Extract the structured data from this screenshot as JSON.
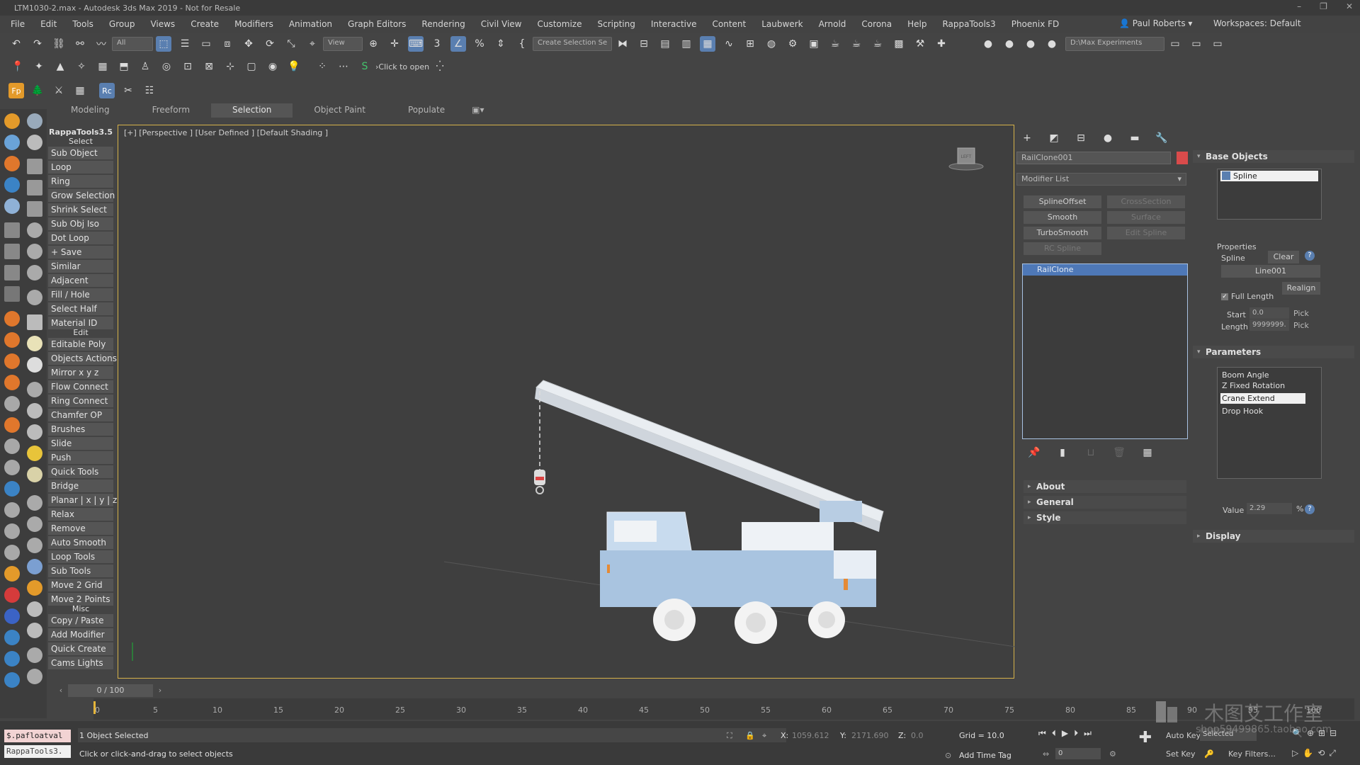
{
  "window": {
    "title": "LTM1030-2.max - Autodesk 3ds Max 2019 - Not for Resale",
    "controls": [
      "–",
      "❐",
      "✕"
    ]
  },
  "menu": {
    "items": [
      "File",
      "Edit",
      "Tools",
      "Group",
      "Views",
      "Create",
      "Modifiers",
      "Animation",
      "Graph Editors",
      "Rendering",
      "Civil View",
      "Customize",
      "Scripting",
      "Interactive",
      "Content",
      "Laubwerk",
      "Arnold",
      "Corona",
      "Help",
      "RappaTools3",
      "Phoenix FD"
    ],
    "user": "Paul Roberts",
    "workspace_label": "Workspaces:",
    "workspace_value": "Default"
  },
  "toolbar": {
    "filter": "All",
    "view": "View",
    "selection_set": "Create Selection Se",
    "project": "D:\\Max Experiments",
    "click_to_open": "›Click to open",
    "spinner_snap": "3"
  },
  "ribbon": {
    "tabs": [
      "Modeling",
      "Freeform",
      "Selection",
      "Object Paint",
      "Populate"
    ],
    "active": "Selection"
  },
  "rappa": {
    "title": "RappaTools3.5",
    "select_header": "Select",
    "select_buttons": [
      "Sub Object",
      "Loop",
      "Ring",
      "Grow Selection",
      "Shrink Select",
      "Sub Obj Iso",
      "Dot Loop",
      "+ Save",
      "Similar",
      "Adjacent",
      "Fill / Hole",
      "Select Half",
      "Material ID"
    ],
    "edit_header": "Edit",
    "edit_buttons": [
      "Editable Poly",
      "Objects Actions",
      "Mirror   x  y  z",
      "Flow Connect",
      "Ring Connect",
      "Chamfer OP",
      "Brushes",
      "Slide",
      "Push",
      "Quick Tools",
      "Bridge",
      "Planar | x | y | z",
      "Relax",
      "Remove",
      "Auto Smooth",
      "Loop Tools",
      "Sub Tools",
      "Move 2 Grid",
      "Move 2 Points"
    ],
    "misc_header": "Misc",
    "misc_buttons": [
      "Copy / Paste",
      "Add Modifier",
      "Quick Create",
      "Cams Lights"
    ]
  },
  "viewport": {
    "label": "[+] [Perspective ] [User Defined ] [Default Shading ]",
    "viewcube": "LEFT"
  },
  "command_panel": {
    "object_name": "RailClone001",
    "object_color": "#d94b4b",
    "modifier_list": "Modifier List",
    "modifier_buttons": [
      {
        "label": "SplineOffset",
        "enabled": true
      },
      {
        "label": "CrossSection",
        "enabled": false
      },
      {
        "label": "Smooth",
        "enabled": true
      },
      {
        "label": "Surface",
        "enabled": false
      },
      {
        "label": "TurboSmooth",
        "enabled": true
      },
      {
        "label": "Edit Spline",
        "enabled": false
      },
      {
        "label": "RC Spline",
        "enabled": false
      }
    ],
    "stack_item": "RailClone",
    "rollouts": [
      "About",
      "General",
      "Style"
    ]
  },
  "right_panel": {
    "base_objects": {
      "title": "Base Objects",
      "items": [
        "Spline"
      ]
    },
    "properties": {
      "title": "Properties",
      "spline_label": "Spline",
      "clear": "Clear",
      "help": "?",
      "spline_value": "Line001",
      "realign": "Realign",
      "full_length": "Full Length",
      "start_label": "Start",
      "start_value": "0.0",
      "length_label": "Length",
      "length_value": "9999999.",
      "pick": "Pick"
    },
    "parameters": {
      "title": "Parameters",
      "items": [
        "Boom Angle",
        "Z Fixed Rotation",
        "Crane Extend",
        "Drop Hook"
      ],
      "selected": "Crane Extend",
      "value_label": "Value",
      "value": "2.29",
      "percent": "%"
    },
    "display": "Display"
  },
  "timeline": {
    "frame": "0 / 100",
    "ticks": [
      "0",
      "5",
      "10",
      "15",
      "20",
      "25",
      "30",
      "35",
      "40",
      "45",
      "50",
      "55",
      "60",
      "65",
      "70",
      "75",
      "80",
      "85",
      "90",
      "95",
      "100"
    ]
  },
  "status": {
    "maxscript_1": "$.pafloatval",
    "maxscript_2": "RappaTools3.",
    "selected": "1 Object Selected",
    "prompt": "Click or click-and-drag to select objects",
    "x_label": "X:",
    "x_value": "1059.612",
    "y_label": "Y:",
    "y_value": "2171.690",
    "z_label": "Z:",
    "z_value": "0.0",
    "grid": "Grid = 10.0",
    "add_time_tag": "Add Time Tag",
    "auto_key": "Auto Key",
    "selected_dd": "Selected",
    "set_key": "Set Key",
    "key_filters": "Key Filters...",
    "frame_spinner": "0"
  },
  "watermark": {
    "text_cn": "木图艾工作室",
    "text_url": "shop59499865.taobao.com"
  }
}
